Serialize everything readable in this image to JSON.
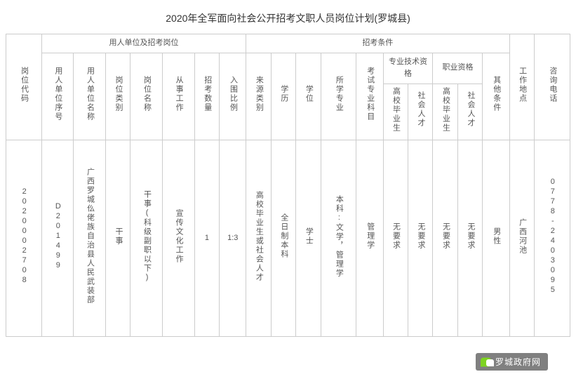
{
  "title": "2020年全军面向社会公开招考文职人员岗位计划(罗城县)",
  "headers": {
    "code": "岗位代码",
    "group_unit": "用人单位及招考岗位",
    "group_cond": "招考条件",
    "seq": "用人单位序号",
    "name": "用人单位名称",
    "type": "岗位类别",
    "pos": "岗位名称",
    "work": "从事工作",
    "num": "招考数量",
    "ratio": "入围比例",
    "src": "来源类别",
    "edu": "学历",
    "deg": "学位",
    "major": "所学专业",
    "subj": "考试专业科目",
    "prof_qual": "专业技术资格",
    "occ_qual": "职业资格",
    "q_grad": "高校毕业生",
    "q_social": "社会人才",
    "other": "其他条件",
    "loc": "工作地点",
    "phone": "咨询电话"
  },
  "row": {
    "code": "2020002708",
    "seq": "D201499",
    "name": "广西罗城仫佬族自治县人民武装部",
    "type": "干事",
    "pos": "干事(科级副职以下)",
    "work": "宣传文化工作",
    "num": "1",
    "ratio": "1:3",
    "src": "高校毕业生或社会人才",
    "edu": "全日制本科",
    "deg": "学士",
    "major": "本科:文学，管理学",
    "subj": "管理学",
    "q1": "无要求",
    "q2": "无要求",
    "q3": "无要求",
    "q4": "无要求",
    "other": "男性",
    "loc": "广西河池",
    "phone": "0778-2403095"
  },
  "wechat": "罗城政府网"
}
